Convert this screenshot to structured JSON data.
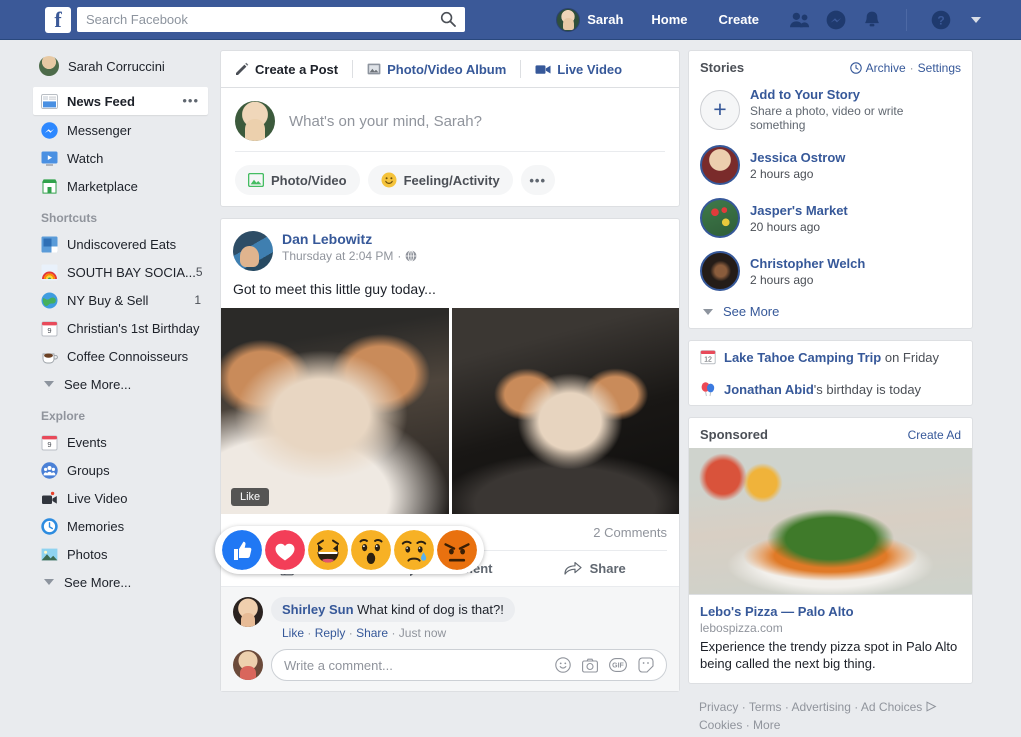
{
  "topnav": {
    "logo": "f",
    "logo_icon": "facebook-logo-icon",
    "search_placeholder": "Search Facebook",
    "search_value": "",
    "search_icon": "search-icon",
    "profile_name": "Sarah",
    "home_label": "Home",
    "create_label": "Create",
    "icons": [
      "friend-requests-icon",
      "messenger-icon",
      "notifications-icon",
      "help-icon",
      "account-menu-caret-icon"
    ]
  },
  "sidebar": {
    "me": {
      "label": "Sarah Corruccini",
      "icon": "profile-avatar-icon"
    },
    "main": [
      {
        "label": "News Feed",
        "icon": "news-feed-icon",
        "active": true,
        "more": "•••"
      },
      {
        "label": "Messenger",
        "icon": "messenger-icon"
      },
      {
        "label": "Watch",
        "icon": "watch-icon"
      },
      {
        "label": "Marketplace",
        "icon": "marketplace-icon"
      }
    ],
    "shortcuts_heading": "Shortcuts",
    "shortcuts": [
      {
        "label": "Undiscovered Eats",
        "icon": "undiscovered-eats-icon",
        "badge": ""
      },
      {
        "label": "SOUTH BAY SOCIA...",
        "icon": "rainbow-icon",
        "badge": "5"
      },
      {
        "label": "NY Buy & Sell",
        "icon": "globe-icon",
        "badge": "1"
      },
      {
        "label": "Christian's 1st Birthday",
        "icon": "calendar-icon",
        "badge": ""
      },
      {
        "label": "Coffee Connoisseurs",
        "icon": "coffee-icon",
        "badge": ""
      }
    ],
    "shortcuts_see_more": "See More...",
    "explore_heading": "Explore",
    "explore": [
      {
        "label": "Events",
        "icon": "calendar-icon"
      },
      {
        "label": "Groups",
        "icon": "groups-icon"
      },
      {
        "label": "Live Video",
        "icon": "live-video-icon"
      },
      {
        "label": "Memories",
        "icon": "memories-icon"
      },
      {
        "label": "Photos",
        "icon": "photos-icon"
      }
    ],
    "explore_see_more": "See More..."
  },
  "composer": {
    "tabs": [
      {
        "label": "Create a Post",
        "icon": "pencil-icon",
        "selected": true
      },
      {
        "label": "Photo/Video Album",
        "icon": "album-icon",
        "selected": false
      },
      {
        "label": "Live Video",
        "icon": "live-video-icon",
        "selected": false
      }
    ],
    "placeholder": "What's on your mind, Sarah?",
    "actions": [
      {
        "label": "Photo/Video",
        "icon": "photo-icon"
      },
      {
        "label": "Feeling/Activity",
        "icon": "smiley-icon"
      }
    ],
    "more_label": "•••"
  },
  "post": {
    "author": "Dan Lebowitz",
    "timestamp": "Thursday at 2:04 PM",
    "separator": "·",
    "privacy_icon": "globe-icon",
    "menu_icon": "post-menu-icon",
    "text": "Got to meet this little guy today...",
    "photos": [
      {
        "alt": "puppy-photo-1"
      },
      {
        "alt": "puppy-photo-2"
      }
    ],
    "like_tooltip": "Like",
    "reactions": [
      {
        "name": "like-reaction",
        "color": "#2078f4"
      },
      {
        "name": "love-reaction",
        "color": "#f33e58"
      },
      {
        "name": "haha-reaction",
        "color": "#f7b125"
      },
      {
        "name": "wow-reaction",
        "color": "#f7b125"
      },
      {
        "name": "sad-reaction",
        "color": "#f7b125"
      },
      {
        "name": "angry-reaction",
        "color": "#e9710f"
      }
    ],
    "comments_count": "2 Comments",
    "actions": [
      {
        "label": "Like",
        "icon": "thumbs-up-icon"
      },
      {
        "label": "Comment",
        "icon": "comment-bubble-icon"
      },
      {
        "label": "Share",
        "icon": "share-arrow-icon"
      }
    ]
  },
  "comments": {
    "items": [
      {
        "author": "Shirley Sun",
        "text": "What kind of dog is that?!",
        "actions": [
          "Like",
          "Reply",
          "Share"
        ],
        "time": "Just now",
        "sep": "·"
      }
    ],
    "input_placeholder": "Write a comment...",
    "input_value": "",
    "tools": [
      "emoji-icon",
      "camera-icon",
      "gif-icon",
      "sticker-icon"
    ]
  },
  "stories": {
    "title": "Stories",
    "archive_label": "Archive",
    "archive_icon": "archive-clock-icon",
    "settings_label": "Settings",
    "separator": "·",
    "add": {
      "title": "Add to Your Story",
      "subtitle": "Share a photo, video or write something",
      "icon": "plus-icon"
    },
    "items": [
      {
        "name": "Jessica Ostrow",
        "time": "2 hours ago",
        "avatar": "jessica-avatar"
      },
      {
        "name": "Jasper's Market",
        "time": "20 hours ago",
        "avatar": "jaspers-market-avatar"
      },
      {
        "name": "Christopher Welch",
        "time": "2 hours ago",
        "avatar": "christopher-avatar"
      }
    ],
    "see_more": "See More"
  },
  "events": [
    {
      "icon": "calendar-icon",
      "bold": "Lake Tahoe Camping Trip",
      "rest": " on Friday"
    },
    {
      "icon": "balloons-icon",
      "bold": "Jonathan Abid",
      "rest": "'s birthday is today"
    }
  ],
  "sponsored": {
    "label": "Sponsored",
    "create_ad": "Create Ad",
    "image_alt": "pizza-with-arugula-photo",
    "title": "Lebo's Pizza — Palo Alto",
    "url": "lebospizza.com",
    "description": "Experience the trendy pizza spot in Palo Alto being called the next big thing."
  },
  "footer": {
    "line1": [
      "Privacy",
      "Terms",
      "Advertising",
      "Ad Choices"
    ],
    "adchoices_icon": "ad-choices-icon",
    "line2": [
      "Cookies",
      "More"
    ],
    "sep": "·"
  },
  "colors": {
    "brand_blue": "#3b5998",
    "link_blue": "#365899",
    "page_bg": "#e9ebee",
    "card_border": "#dddfe2",
    "muted": "#90949c"
  }
}
